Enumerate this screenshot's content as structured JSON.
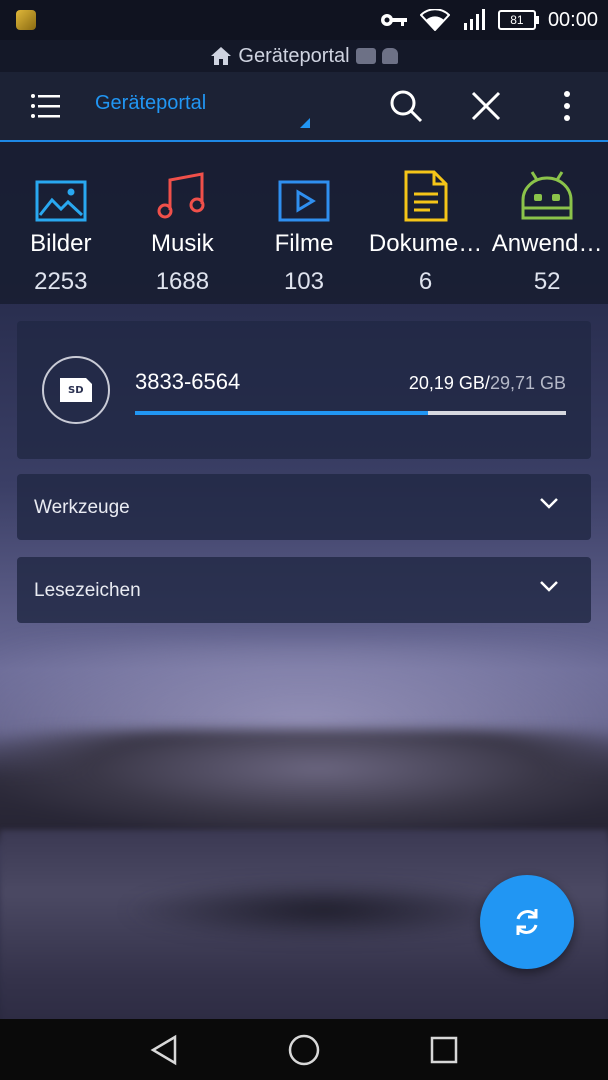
{
  "status_bar": {
    "battery": "81",
    "time": "00:00",
    "icons": [
      "app-notification-icon",
      "key-icon",
      "wifi-icon",
      "signal-icon",
      "battery-icon"
    ]
  },
  "location_bar": {
    "text": "Geräteportal",
    "icons": [
      "home-icon",
      "sd-card-icon",
      "android-icon"
    ]
  },
  "toolbar": {
    "title": "Geräteportal",
    "icons": [
      "menu-icon",
      "search-icon",
      "close-icon",
      "more-vert-icon"
    ],
    "accent": "#2196f3"
  },
  "categories": [
    {
      "name": "Bilder",
      "count": "2253",
      "icon": "image-icon",
      "color": "#29a8f0"
    },
    {
      "name": "Musik",
      "count": "1688",
      "icon": "music-icon",
      "color": "#f0504a"
    },
    {
      "name": "Filme",
      "count": "103",
      "icon": "video-icon",
      "color": "#2f8ff0"
    },
    {
      "name": "Dokume…",
      "count": "6",
      "icon": "document-icon",
      "color": "#f5c518"
    },
    {
      "name": "Anwend…",
      "count": "52",
      "icon": "android-app-icon",
      "color": "#8bc34a"
    }
  ],
  "storage": {
    "label": "3833-6564",
    "used": "20,19 GB",
    "separator": "/",
    "total": "29,71 GB",
    "used_fraction": 0.68,
    "icon": "sd-card-icon"
  },
  "sections": [
    {
      "label": "Werkzeuge",
      "icon": "chevron-down-icon"
    },
    {
      "label": "Lesezeichen",
      "icon": "chevron-down-icon"
    }
  ],
  "fab": {
    "icon": "refresh-icon",
    "color": "#2196f3"
  },
  "nav": {
    "icons": [
      "back-icon",
      "home-circle-icon",
      "recents-icon"
    ]
  }
}
